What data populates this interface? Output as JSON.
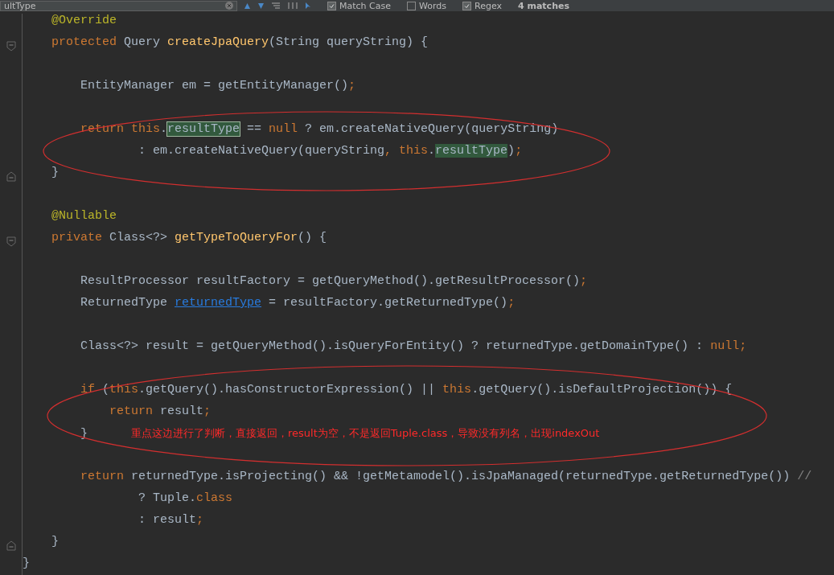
{
  "find_bar": {
    "query": "ultType",
    "options": [
      {
        "label": "Match Case",
        "checked": true
      },
      {
        "label": "Words",
        "checked": false
      },
      {
        "label": "Regex",
        "checked": true
      }
    ],
    "match_count": "4 matches"
  },
  "lines": [
    {
      "kind": "group",
      "children": [
        {
          "kind": "code",
          "tokens": [
            {
              "kind": "ann",
              "t": "@Override"
            }
          ]
        },
        {
          "kind": "fold_start",
          "tokens": [
            {
              "kind": "kw",
              "t": "protected "
            },
            {
              "kind": "p",
              "t": "Query "
            },
            {
              "kind": "fn",
              "t": "createJpaQuery"
            },
            {
              "kind": "p",
              "t": "(String queryString) {"
            }
          ],
          "children": [
            {
              "kind": "blank"
            },
            {
              "kind": "code",
              "tokens": [
                {
                  "kind": "p",
                  "t": "EntityManager em = getEntityManager()"
                },
                {
                  "kind": "kw",
                  "t": ";"
                }
              ]
            },
            {
              "kind": "blank"
            },
            {
              "kind": "code",
              "tokens": [
                {
                  "kind": "kw",
                  "t": "return this"
                },
                {
                  "kind": "p",
                  "t": "."
                },
                {
                  "kind": "match_current",
                  "t": "resultType"
                },
                {
                  "kind": "p",
                  "t": " == "
                },
                {
                  "kind": "kw",
                  "t": "null"
                },
                {
                  "kind": "p",
                  "t": " ? em.createNativeQuery(queryString)"
                }
              ]
            },
            {
              "kind": "continuation",
              "tokens": [
                {
                  "kind": "p",
                  "t": ": em.createNativeQuery(queryString"
                },
                {
                  "kind": "kw",
                  "t": ", this"
                },
                {
                  "kind": "p",
                  "t": "."
                },
                {
                  "kind": "match",
                  "t": "resultType"
                },
                {
                  "kind": "p",
                  "t": ")"
                },
                {
                  "kind": "kw",
                  "t": ";"
                }
              ]
            }
          ]
        },
        {
          "kind": "fold_end",
          "tokens": [
            {
              "kind": "p",
              "t": "}"
            }
          ]
        },
        {
          "kind": "blank"
        },
        {
          "kind": "code",
          "tokens": [
            {
              "kind": "ann",
              "t": "@Nullable"
            }
          ]
        },
        {
          "kind": "fold_start",
          "tokens": [
            {
              "kind": "kw",
              "t": "private "
            },
            {
              "kind": "p",
              "t": "Class<?> "
            },
            {
              "kind": "fn",
              "t": "getTypeToQueryFor"
            },
            {
              "kind": "p",
              "t": "() {"
            }
          ],
          "children": [
            {
              "kind": "blank"
            },
            {
              "kind": "code",
              "tokens": [
                {
                  "kind": "p",
                  "t": "ResultProcessor resultFactory = getQueryMethod().getResultProcessor()"
                },
                {
                  "kind": "kw",
                  "t": ";"
                }
              ]
            },
            {
              "kind": "code",
              "tokens": [
                {
                  "kind": "p",
                  "t": "ReturnedType "
                },
                {
                  "kind": "link",
                  "t": "returnedType"
                },
                {
                  "kind": "p",
                  "t": " = resultFactory.getReturnedType()"
                },
                {
                  "kind": "kw",
                  "t": ";"
                }
              ]
            },
            {
              "kind": "blank"
            },
            {
              "kind": "code",
              "tokens": [
                {
                  "kind": "p",
                  "t": "Class<?> result = getQueryMethod().isQueryForEntity() ? returnedType.getDomainType() : "
                },
                {
                  "kind": "kw",
                  "t": "null;"
                }
              ]
            },
            {
              "kind": "blank"
            },
            {
              "kind": "code",
              "tokens": [
                {
                  "kind": "kw",
                  "t": "if "
                },
                {
                  "kind": "p",
                  "t": "("
                },
                {
                  "kind": "kw",
                  "t": "this"
                },
                {
                  "kind": "p",
                  "t": ".getQuery().hasConstructorExpression() || "
                },
                {
                  "kind": "kw",
                  "t": "this"
                },
                {
                  "kind": "p",
                  "t": ".getQuery().isDefaultProjection()) {"
                }
              ],
              "children": [
                {
                  "kind": "code",
                  "tokens": [
                    {
                      "kind": "kw",
                      "t": "return "
                    },
                    {
                      "kind": "p",
                      "t": "result"
                    },
                    {
                      "kind": "kw",
                      "t": ";"
                    }
                  ]
                }
              ]
            },
            {
              "kind": "code",
              "tokens": [
                {
                  "kind": "p",
                  "t": "}"
                },
                {
                  "kind": "note",
                  "t": "重点这边进行了判断，直接返回，result为空，不是返回Tuple.class，导致没有列名，出现indexOut"
                }
              ]
            },
            {
              "kind": "blank"
            },
            {
              "kind": "code",
              "tokens": [
                {
                  "kind": "kw",
                  "t": "return "
                },
                {
                  "kind": "p",
                  "t": "returnedType.isProjecting() && !getMetamodel().isJpaManaged(returnedType.getReturnedType()) "
                },
                {
                  "kind": "cm",
                  "t": "//"
                }
              ]
            },
            {
              "kind": "continuation",
              "tokens": [
                {
                  "kind": "p",
                  "t": "? Tuple."
                },
                {
                  "kind": "kw",
                  "t": "class"
                }
              ]
            },
            {
              "kind": "continuation",
              "tokens": [
                {
                  "kind": "p",
                  "t": ": result"
                },
                {
                  "kind": "kw",
                  "t": ";"
                }
              ]
            }
          ]
        },
        {
          "kind": "fold_end",
          "tokens": [
            {
              "kind": "p",
              "t": "}"
            }
          ]
        }
      ]
    },
    {
      "kind": "code",
      "tokens": [
        {
          "kind": "p",
          "t": "}"
        }
      ]
    }
  ]
}
